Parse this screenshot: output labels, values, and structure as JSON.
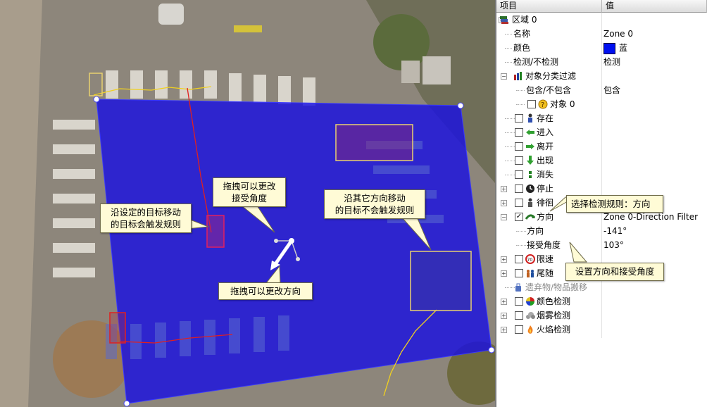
{
  "panel": {
    "col_item": "项目",
    "col_value": "值",
    "rows": [
      {
        "label": "区域 0",
        "value": ""
      },
      {
        "label": "名称",
        "value": "Zone 0"
      },
      {
        "label": "颜色",
        "value": "蓝"
      },
      {
        "label": "检测/不检测",
        "value": "检测"
      },
      {
        "label": "对象分类过滤",
        "value": ""
      },
      {
        "label": "包含/不包含",
        "value": "包含"
      },
      {
        "label": "对象 0",
        "value": ""
      },
      {
        "label": "存在",
        "value": ""
      },
      {
        "label": "进入",
        "value": ""
      },
      {
        "label": "离开",
        "value": ""
      },
      {
        "label": "出现",
        "value": ""
      },
      {
        "label": "消失",
        "value": ""
      },
      {
        "label": "停止",
        "value": ""
      },
      {
        "label": "徘徊",
        "value": ""
      },
      {
        "label": "方向",
        "value": "Zone 0-Direction Filter"
      },
      {
        "label": "方向",
        "value": "-141°"
      },
      {
        "label": "接受角度",
        "value": "103°"
      },
      {
        "label": "限速",
        "value": ""
      },
      {
        "label": "尾随",
        "value": ""
      },
      {
        "label": "遗弃物/物品搬移",
        "value": ""
      },
      {
        "label": "颜色检测",
        "value": ""
      },
      {
        "label": "烟雾检测",
        "value": ""
      },
      {
        "label": "火焰检测",
        "value": ""
      }
    ],
    "swatch_color": "#0010f0"
  },
  "callouts": {
    "angle": [
      "拖拽可以更改",
      "接受角度"
    ],
    "target": [
      "沿设定的目标移动",
      "的目标会触发规则"
    ],
    "other": [
      "沿其它方向移动",
      "的目标不会触发规则"
    ],
    "direction": "拖拽可以更改方向",
    "select_rule": "选择检测规则：方向",
    "set_direction": "设置方向和接受角度"
  },
  "colors": {
    "zone": "#1a10e0",
    "zone_fill_opacity": 0.82,
    "callout_bg": "#fffbd6",
    "target_box": "#e8d070",
    "track_red": "#e02020",
    "track_yellow": "#f0d020"
  }
}
